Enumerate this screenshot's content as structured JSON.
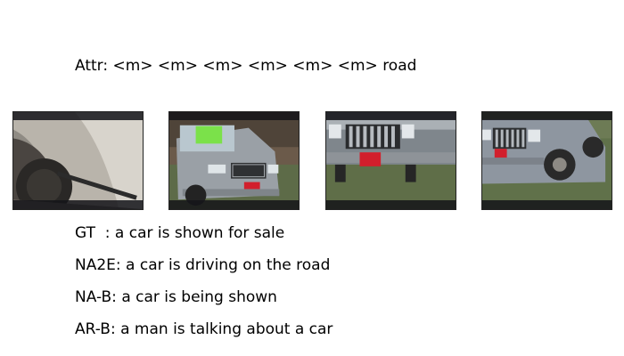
{
  "attr_line": "Attr: <m> <m> <m> <m> <m> <m> road",
  "captions": [
    {
      "label": "GT  ",
      "text": "a car is shown for sale"
    },
    {
      "label": "NA2E",
      "text": "a car is driving on the road"
    },
    {
      "label": "NA-B",
      "text": "a car is being shown"
    },
    {
      "label": "AR-B",
      "text": "a man is talking about a car"
    }
  ],
  "frames": [
    {
      "subject": "car-fender-closeup"
    },
    {
      "subject": "car-front-with-sale-sign"
    },
    {
      "subject": "car-grille-closeup"
    },
    {
      "subject": "car-front-three-quarter"
    }
  ]
}
